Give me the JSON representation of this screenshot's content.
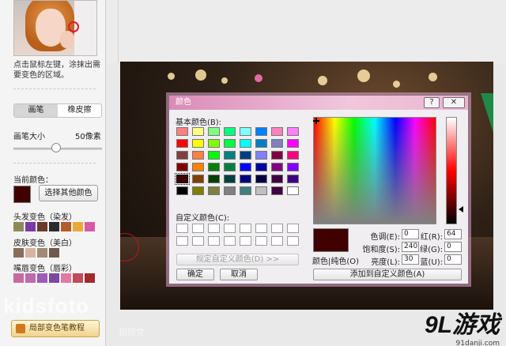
{
  "sidebar": {
    "hint": "点击鼠标左键，涂抹出需要变色的区域。",
    "tab_brush": "画笔",
    "tab_eraser": "橡皮擦",
    "brush_size_label": "画笔大小",
    "brush_size_value": "50像素",
    "brush_size_level": 0.48,
    "current_color_label": "当前颜色：",
    "current_color": "#400000",
    "choose_other_color": "选择其他颜色",
    "hair_label": "头发变色（染发）",
    "hair_colors": [
      "#8d8a5a",
      "#7b3aa6",
      "#6e3a2a",
      "#2b2b2b",
      "#b55a2a",
      "#e9a93a",
      "#d65aa6"
    ],
    "skin_label": "皮肤变色（美白）",
    "skin_colors": [
      "#8a6e5a",
      "#d8b5a3",
      "#a18a77",
      "#6e5b4b"
    ],
    "lip_label": "嘴唇变色（唇彩）",
    "lip_colors": [
      "#c86aa0",
      "#c06ab0",
      "#a05ab8",
      "#7a4aa0",
      "#e07aa0",
      "#c04a5a",
      "#a02a2a"
    ],
    "tutorial_button": "局部变色笔教程",
    "watermark": "kidsfoto",
    "watermark_sub": "拍照党"
  },
  "dialog": {
    "title": "颜色",
    "help_button": "?",
    "close_button": "✕",
    "basic_colors_label": "基本颜色(B):",
    "basic_colors": [
      "#ff8080",
      "#ffff80",
      "#80ff80",
      "#00ff80",
      "#80ffff",
      "#0080ff",
      "#ff80c0",
      "#ff80ff",
      "#ff0000",
      "#ffff00",
      "#80ff00",
      "#00ff40",
      "#00ffff",
      "#0080c0",
      "#8080c0",
      "#ff00ff",
      "#804040",
      "#ff8040",
      "#00ff00",
      "#008080",
      "#004080",
      "#8080ff",
      "#800040",
      "#ff0080",
      "#800000",
      "#ff8000",
      "#008000",
      "#008040",
      "#0000ff",
      "#0000a0",
      "#800080",
      "#8000ff",
      "#400000",
      "#804000",
      "#004000",
      "#004040",
      "#000080",
      "#000040",
      "#400040",
      "#400080",
      "#000000",
      "#808000",
      "#808040",
      "#808080",
      "#408080",
      "#c0c0c0",
      "#400040",
      "#ffffff"
    ],
    "selected_basic_index": 32,
    "custom_colors_label": "自定义颜色(C):",
    "custom_colors_count": 16,
    "define_custom_button": "规定自定义颜色(D) >>",
    "ok_button": "确定",
    "cancel_button": "取消",
    "color_solid_label": "颜色|纯色(O)",
    "add_custom_button": "添加到自定义颜色(A)",
    "hue_label": "色调(E):",
    "hue_value": "0",
    "sat_label": "饱和度(S):",
    "sat_value": "240",
    "lum_label": "亮度(L):",
    "lum_value": "30",
    "red_label": "红(R):",
    "red_value": "64",
    "green_label": "绿(G):",
    "green_value": "0",
    "blue_label": "蓝(U):",
    "blue_value": "0",
    "preview_color": "#400000"
  },
  "logo": {
    "brand": "9L游戏",
    "url": "91danji.com"
  }
}
